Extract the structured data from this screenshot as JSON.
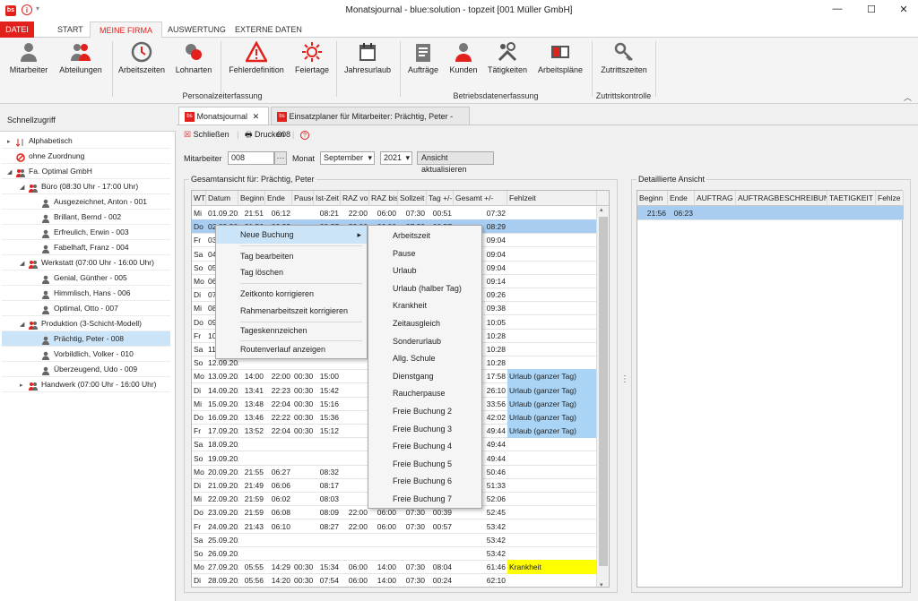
{
  "window": {
    "title": "Monatsjournal - blue:solution - topzeit [001 Müller GmbH]",
    "logo": "bs",
    "minimize": "—",
    "maximize": "☐",
    "close": "✕"
  },
  "menu_tabs": [
    "DATEI",
    "START",
    "MEINE FIRMA",
    "AUSWERTUNG",
    "EXTERNE DATEN"
  ],
  "ribbon": {
    "buttons": [
      {
        "label": "Mitarbeiter",
        "icon": "person-icon"
      },
      {
        "label": "Abteilungen",
        "icon": "group-icon"
      },
      {
        "label": "Arbeitszeiten",
        "icon": "clock-icon"
      },
      {
        "label": "Lohnarten",
        "icon": "money-icon"
      },
      {
        "label": "Fehlerdefinition",
        "icon": "warning-icon"
      },
      {
        "label": "Feiertage",
        "icon": "sun-icon"
      },
      {
        "label": "Jahresurlaub",
        "icon": "calendar-icon"
      },
      {
        "label": "Aufträge",
        "icon": "clipboard-icon"
      },
      {
        "label": "Kunden",
        "icon": "customer-icon"
      },
      {
        "label": "Tätigkeiten",
        "icon": "tools-icon"
      },
      {
        "label": "Arbeitspläne",
        "icon": "plan-icon"
      },
      {
        "label": "Zutrittszeiten",
        "icon": "key-icon"
      }
    ],
    "groups": [
      "Personalzeiterfassung",
      "Betriebsdatenerfassung",
      "Zutrittskontrolle"
    ]
  },
  "sidebar": {
    "title": "Schnellzugriff",
    "items": [
      {
        "label": "Alphabetisch",
        "level": 0,
        "expander": "▸",
        "icon": "sort-icon"
      },
      {
        "label": "ohne Zuordnung",
        "level": 0,
        "expander": "",
        "icon": "no-icon"
      },
      {
        "label": "Fa. Optimal GmbH",
        "level": 0,
        "expander": "◢",
        "icon": "company-icon"
      },
      {
        "label": "Büro (08:30 Uhr - 17:00 Uhr)",
        "level": 1,
        "expander": "◢",
        "icon": "department-icon"
      },
      {
        "label": "Ausgezeichnet, Anton - 001",
        "level": 2,
        "expander": "",
        "icon": "person-icon"
      },
      {
        "label": "Brillant, Bernd - 002",
        "level": 2,
        "expander": "",
        "icon": "person-icon"
      },
      {
        "label": "Erfreulich, Erwin - 003",
        "level": 2,
        "expander": "",
        "icon": "person-icon"
      },
      {
        "label": "Fabelhaft, Franz - 004",
        "level": 2,
        "expander": "",
        "icon": "person-icon"
      },
      {
        "label": "Werkstatt (07:00 Uhr - 16:00 Uhr)",
        "level": 1,
        "expander": "◢",
        "icon": "department-icon"
      },
      {
        "label": "Genial, Günther - 005",
        "level": 2,
        "expander": "",
        "icon": "person-icon"
      },
      {
        "label": "Himmlisch, Hans - 006",
        "level": 2,
        "expander": "",
        "icon": "person-icon"
      },
      {
        "label": "Optimal, Otto - 007",
        "level": 2,
        "expander": "",
        "icon": "person-icon"
      },
      {
        "label": "Produktion (3-Schicht-Modell)",
        "level": 1,
        "expander": "◢",
        "icon": "department-icon"
      },
      {
        "label": "Prächtig, Peter - 008",
        "level": 2,
        "expander": "",
        "icon": "person-icon",
        "selected": true
      },
      {
        "label": "Vorbildlich, Volker - 010",
        "level": 2,
        "expander": "",
        "icon": "person-icon"
      },
      {
        "label": "Überzeugend, Udo - 009",
        "level": 2,
        "expander": "",
        "icon": "person-icon"
      },
      {
        "label": "Handwerk (07:00 Uhr - 16:00 Uhr)",
        "level": 1,
        "expander": "▸",
        "icon": "department-icon"
      }
    ]
  },
  "doc_tabs": [
    {
      "label": "Monatsjournal",
      "close": "✕"
    },
    {
      "label": "Einsatzplaner für Mitarbeiter: Prächtig, Peter - 008"
    }
  ],
  "toolbar": {
    "close_label": "Schließen",
    "print_label": "Drucken",
    "help": "?"
  },
  "filters": {
    "mitarbeiter_label": "Mitarbeiter",
    "mitarbeiter_value": "008",
    "dots": "···",
    "monat_label": "Monat",
    "monat_value": "September",
    "jahr_value": "2021",
    "refresh_label": "Ansicht aktualisieren"
  },
  "overview": {
    "title": "Gesamtansicht für: Prächtig, Peter",
    "columns": [
      "WT",
      "Datum",
      "Beginn",
      "Ende",
      "Pause",
      "Ist-Zeit",
      "RAZ von",
      "RAZ bis",
      "Sollzeit",
      "Tag +/-",
      "Gesamt +/-",
      "Fehlzeit"
    ],
    "rows": [
      [
        "Mi",
        "01.09.2021",
        "21:51",
        "06:12",
        "",
        "08:21",
        "22:00",
        "06:00",
        "07:30",
        "00:51",
        "07:32",
        ""
      ],
      [
        "Do",
        "02.09.2021",
        "21:56",
        "06:23",
        "",
        "08:27",
        "22:00",
        "06:00",
        "07:30",
        "00:57",
        "08:29",
        ""
      ],
      [
        "Fr",
        "03.09.2021",
        "",
        "",
        "",
        "",
        "",
        "",
        "",
        "",
        "09:04",
        ""
      ],
      [
        "Sa",
        "04.09.2021",
        "",
        "",
        "",
        "",
        "",
        "",
        "",
        "",
        "09:04",
        ""
      ],
      [
        "So",
        "05.09.2021",
        "",
        "",
        "",
        "",
        "",
        "",
        "",
        "",
        "09:04",
        ""
      ],
      [
        "Mo",
        "06.09.2021",
        "",
        "",
        "",
        "",
        "",
        "",
        "",
        "",
        "09:14",
        ""
      ],
      [
        "Di",
        "07.09.2021",
        "",
        "",
        "",
        "",
        "",
        "",
        "",
        "",
        "09:26",
        ""
      ],
      [
        "Mi",
        "08.09.2021",
        "",
        "",
        "",
        "",
        "",
        "",
        "",
        "",
        "09:38",
        ""
      ],
      [
        "Do",
        "09.09.2021",
        "",
        "",
        "",
        "",
        "",
        "",
        "",
        "",
        "10:05",
        ""
      ],
      [
        "Fr",
        "10.09.2021",
        "",
        "",
        "",
        "",
        "",
        "",
        "",
        "",
        "10:28",
        ""
      ],
      [
        "Sa",
        "11.09.2021",
        "",
        "",
        "",
        "",
        "",
        "",
        "",
        "",
        "10:28",
        ""
      ],
      [
        "So",
        "12.09.2021",
        "",
        "",
        "",
        "",
        "",
        "",
        "",
        "",
        "10:28",
        ""
      ],
      [
        "Mo",
        "13.09.2021",
        "14:00",
        "22:00",
        "00:30",
        "15:00",
        "",
        "",
        "",
        "",
        "17:58",
        "Urlaub (ganzer Tag)"
      ],
      [
        "Di",
        "14.09.2021",
        "13:41",
        "22:23",
        "00:30",
        "15:42",
        "",
        "",
        "",
        "",
        "26:10",
        "Urlaub (ganzer Tag)"
      ],
      [
        "Mi",
        "15.09.2021",
        "13:48",
        "22:04",
        "00:30",
        "15:16",
        "",
        "",
        "",
        "",
        "33:56",
        "Urlaub (ganzer Tag)"
      ],
      [
        "Do",
        "16.09.2021",
        "13:46",
        "22:22",
        "00:30",
        "15:36",
        "",
        "",
        "",
        "",
        "42:02",
        "Urlaub (ganzer Tag)"
      ],
      [
        "Fr",
        "17.09.2021",
        "13:52",
        "22:04",
        "00:30",
        "15:12",
        "",
        "",
        "",
        "",
        "49:44",
        "Urlaub (ganzer Tag)"
      ],
      [
        "Sa",
        "18.09.2021",
        "",
        "",
        "",
        "",
        "",
        "",
        "",
        "",
        "49:44",
        ""
      ],
      [
        "So",
        "19.09.2021",
        "",
        "",
        "",
        "",
        "",
        "",
        "",
        "",
        "49:44",
        ""
      ],
      [
        "Mo",
        "20.09.2021",
        "21:55",
        "06:27",
        "",
        "08:32",
        "",
        "",
        "",
        "",
        "50:46",
        ""
      ],
      [
        "Di",
        "21.09.2021",
        "21:49",
        "06:06",
        "",
        "08:17",
        "",
        "",
        "",
        "",
        "51:33",
        ""
      ],
      [
        "Mi",
        "22.09.2021",
        "21:59",
        "06:02",
        "",
        "08:03",
        "",
        "",
        "",
        "",
        "52:06",
        ""
      ],
      [
        "Do",
        "23.09.2021",
        "21:59",
        "06:08",
        "",
        "08:09",
        "22:00",
        "06:00",
        "07:30",
        "00:39",
        "52:45",
        ""
      ],
      [
        "Fr",
        "24.09.2021",
        "21:43",
        "06:10",
        "",
        "08:27",
        "22:00",
        "06:00",
        "07:30",
        "00:57",
        "53:42",
        ""
      ],
      [
        "Sa",
        "25.09.2021",
        "",
        "",
        "",
        "",
        "",
        "",
        "",
        "",
        "53:42",
        ""
      ],
      [
        "So",
        "26.09.2021",
        "",
        "",
        "",
        "",
        "",
        "",
        "",
        "",
        "53:42",
        ""
      ],
      [
        "Mo",
        "27.09.2021",
        "05:55",
        "14:29",
        "00:30",
        "15:34",
        "06:00",
        "14:00",
        "07:30",
        "08:04",
        "61:46",
        "Krankheit"
      ],
      [
        "Di",
        "28.09.2021",
        "05:56",
        "14:20",
        "00:30",
        "07:54",
        "06:00",
        "14:00",
        "07:30",
        "00:24",
        "62:10",
        ""
      ]
    ]
  },
  "context_menu": {
    "items": [
      "Neue Buchung",
      "Tag bearbeiten",
      "Tag löschen",
      "Zeitkonto korrigieren",
      "Rahmenarbeitszeit korrigieren",
      "Tageskennzeichen",
      "Routenverlauf anzeigen"
    ],
    "submenu_arrow": "▸"
  },
  "submenu": {
    "items": [
      "Arbeitszeit",
      "Pause",
      "Urlaub",
      "Urlaub (halber Tag)",
      "Krankheit",
      "Zeitausgleich",
      "Sonderurlaub",
      "Allg. Schule",
      "Dienstgang",
      "Raucherpause",
      "Freie Buchung 2",
      "Freie Buchung 3",
      "Freie Buchung 4",
      "Freie Buchung 5",
      "Freie Buchung 6",
      "Freie Buchung 7"
    ]
  },
  "detail": {
    "title": "Detaillierte Ansicht",
    "columns": [
      "Beginn",
      "Ende",
      "AUFTRAG",
      "AUFTRAGBESCHREIBUNG",
      "TAETIGKEIT",
      "Fehlze"
    ],
    "rows": [
      [
        "21:56",
        "06:23",
        "",
        "",
        "",
        ""
      ]
    ]
  },
  "colors": {
    "accent": "#e2211c",
    "selection": "#a9cdf1",
    "vacation": "#a9d4f5",
    "sick": "#ffff00"
  }
}
